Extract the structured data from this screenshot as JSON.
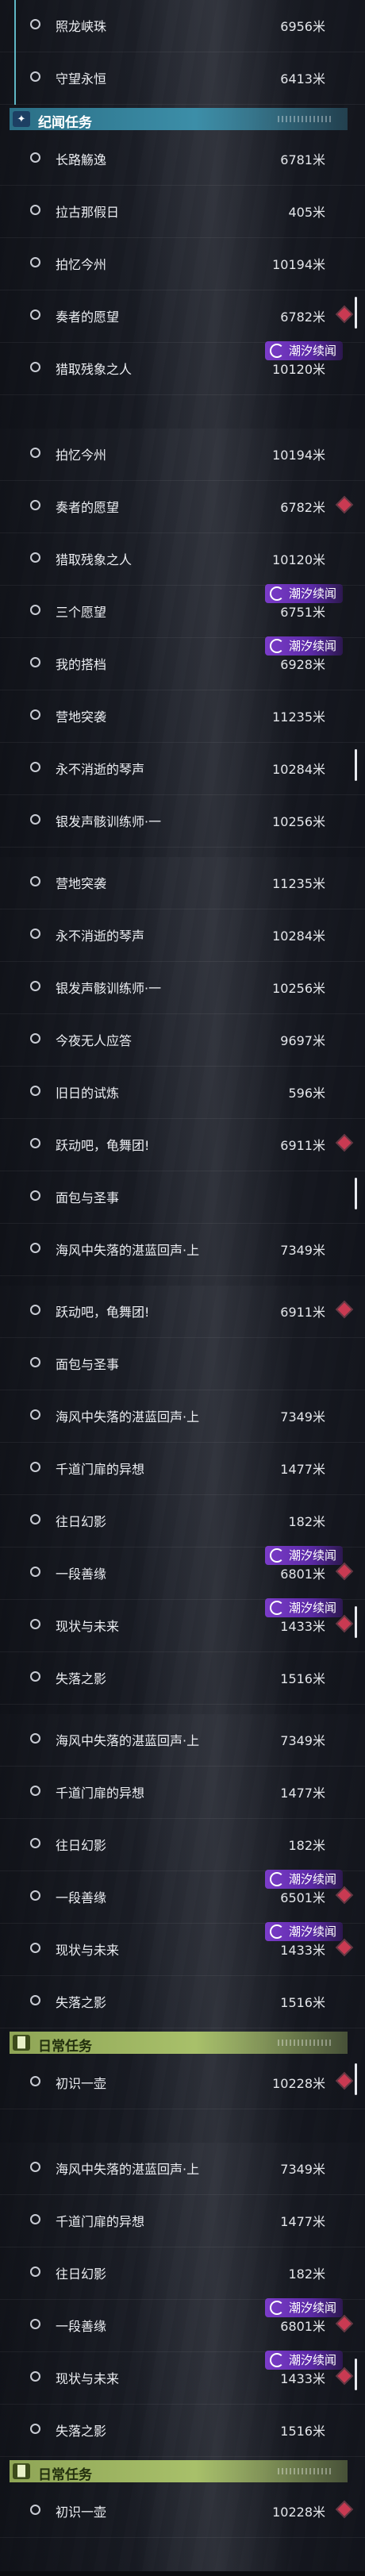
{
  "labels": {
    "event_badge": "潮汐续闻"
  },
  "colors": {
    "story_header": "#3c8ea8",
    "daily_header": "#a8c06a",
    "event_badge": "#7b3cc9",
    "map_marker": "#c93a52",
    "tracked_bar": "#5fb7c4"
  },
  "icons": {
    "story_header": "sparkle-icon",
    "daily_header": "book-icon",
    "row": "radio-circle-icon",
    "event_badge": "swirl-icon",
    "marker": "diamond-marker-icon"
  },
  "panels": [
    {
      "rows": [
        {
          "type": "task",
          "name": "照龙峡珠",
          "distance": "6956米",
          "tracked": true
        },
        {
          "type": "task",
          "name": "守望永恒",
          "distance": "6413米",
          "tracked": true
        },
        {
          "type": "header",
          "style": "story",
          "title": "纪闻任务"
        },
        {
          "type": "task",
          "name": "长路觞逸",
          "distance": "6781米"
        },
        {
          "type": "task",
          "name": "拉古那假日",
          "distance": "405米"
        },
        {
          "type": "task",
          "name": "拍忆今州",
          "distance": "10194米"
        },
        {
          "type": "task",
          "name": "奏者的愿望",
          "distance": "6782米",
          "marker": true,
          "scrollbar": true
        },
        {
          "type": "task",
          "name": "猎取残象之人",
          "distance": "10120米",
          "event": true
        }
      ]
    },
    {
      "rows": [
        {
          "type": "task",
          "name": "拍忆今州",
          "distance": "10194米"
        },
        {
          "type": "task",
          "name": "奏者的愿望",
          "distance": "6782米",
          "marker": true
        },
        {
          "type": "task",
          "name": "猎取残象之人",
          "distance": "10120米"
        },
        {
          "type": "task",
          "name": "三个愿望",
          "distance": "6751米",
          "event": true
        },
        {
          "type": "task",
          "name": "我的搭档",
          "distance": "6928米",
          "event": true
        },
        {
          "type": "task",
          "name": "营地突袭",
          "distance": "11235米"
        },
        {
          "type": "task",
          "name": "永不消逝的琴声",
          "distance": "10284米",
          "scrollbar": true
        },
        {
          "type": "task",
          "name": "银发声骸训练师·一",
          "distance": "10256米"
        }
      ]
    },
    {
      "rows": [
        {
          "type": "task",
          "name": "营地突袭",
          "distance": "11235米"
        },
        {
          "type": "task",
          "name": "永不消逝的琴声",
          "distance": "10284米"
        },
        {
          "type": "task",
          "name": "银发声骸训练师·一",
          "distance": "10256米"
        },
        {
          "type": "task",
          "name": "今夜无人应答",
          "distance": "9697米"
        },
        {
          "type": "task",
          "name": "旧日的试炼",
          "distance": "596米"
        },
        {
          "type": "task",
          "name": "跃动吧，龟舞团!",
          "distance": "6911米",
          "marker": true
        },
        {
          "type": "task",
          "name": "面包与圣事",
          "distance": "",
          "scrollbar": true
        },
        {
          "type": "task",
          "name": "海风中失落的湛蓝回声·上",
          "distance": "7349米"
        }
      ]
    },
    {
      "rows": [
        {
          "type": "task",
          "name": "跃动吧，龟舞团!",
          "distance": "6911米",
          "marker": true
        },
        {
          "type": "task",
          "name": "面包与圣事",
          "distance": ""
        },
        {
          "type": "task",
          "name": "海风中失落的湛蓝回声·上",
          "distance": "7349米"
        },
        {
          "type": "task",
          "name": "千道门扉的异想",
          "distance": "1477米"
        },
        {
          "type": "task",
          "name": "往日幻影",
          "distance": "182米"
        },
        {
          "type": "task",
          "name": "一段善缘",
          "distance": "6801米",
          "event": true,
          "marker": true
        },
        {
          "type": "task",
          "name": "现状与未来",
          "distance": "1433米",
          "event": true,
          "marker": true,
          "scrollbar": true
        },
        {
          "type": "task",
          "name": "失落之影",
          "distance": "1516米"
        }
      ]
    },
    {
      "rows": [
        {
          "type": "task",
          "name": "海风中失落的湛蓝回声·上",
          "distance": "7349米"
        },
        {
          "type": "task",
          "name": "千道门扉的异想",
          "distance": "1477米"
        },
        {
          "type": "task",
          "name": "往日幻影",
          "distance": "182米"
        },
        {
          "type": "task",
          "name": "一段善缘",
          "distance": "6501米",
          "event": true,
          "marker": true
        },
        {
          "type": "task",
          "name": "现状与未来",
          "distance": "1433米",
          "event": true,
          "marker": true
        },
        {
          "type": "task",
          "name": "失落之影",
          "distance": "1516米"
        },
        {
          "type": "header",
          "style": "daily",
          "title": "日常任务"
        },
        {
          "type": "task",
          "name": "初识一壶",
          "distance": "10228米",
          "marker": true,
          "scrollbar": true
        }
      ]
    },
    {
      "rows": [
        {
          "type": "task",
          "name": "海风中失落的湛蓝回声·上",
          "distance": "7349米"
        },
        {
          "type": "task",
          "name": "千道门扉的异想",
          "distance": "1477米"
        },
        {
          "type": "task",
          "name": "往日幻影",
          "distance": "182米"
        },
        {
          "type": "task",
          "name": "一段善缘",
          "distance": "6801米",
          "event": true,
          "marker": true
        },
        {
          "type": "task",
          "name": "现状与未来",
          "distance": "1433米",
          "event": true,
          "marker": true,
          "scrollbar": true
        },
        {
          "type": "task",
          "name": "失落之影",
          "distance": "1516米"
        },
        {
          "type": "header",
          "style": "daily",
          "title": "日常任务"
        },
        {
          "type": "task",
          "name": "初识一壶",
          "distance": "10228米",
          "marker": true
        }
      ]
    }
  ]
}
